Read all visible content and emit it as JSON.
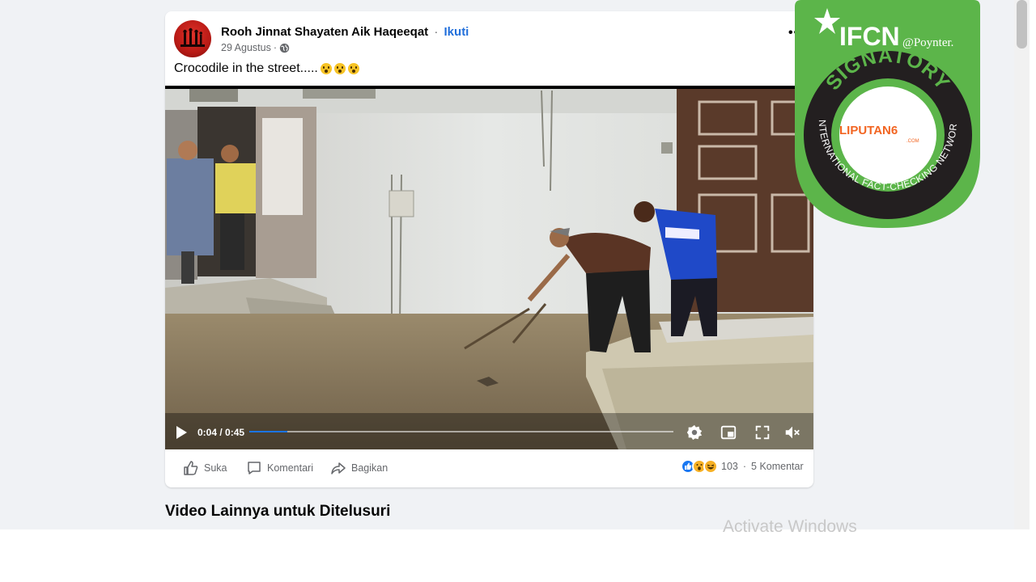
{
  "post": {
    "author": "Rooh Jinnat Shayaten Aik Haqeeqat",
    "separator": "·",
    "follow_label": "Ikuti",
    "date": "29 Agustus",
    "meta_separator": "·",
    "more_label": "•••",
    "caption": "Crocodile in the street.....",
    "caption_emoji": "hushed-face-emoji"
  },
  "video": {
    "time_current": "0:04",
    "time_separator": " / ",
    "time_total": "0:45",
    "progress": 0.09,
    "icons": [
      "play-icon",
      "settings-icon",
      "miniplayer-icon",
      "fullscreen-icon",
      "mute-icon"
    ]
  },
  "actions": {
    "like_label": "Suka",
    "comment_label": "Komentari",
    "share_label": "Bagikan"
  },
  "stats": {
    "reaction_types": [
      "like",
      "wow",
      "haha"
    ],
    "reaction_count": "103",
    "separator": "·",
    "comments": "5 Komentar"
  },
  "section_heading": "Video Lainnya untuk Ditelusuri",
  "system_watermark": "Activate Windows",
  "badge": {
    "brand": "IFCN",
    "partner": "@Poynter.",
    "status": "SIGNATORY",
    "member_logo": "LIPUTAN6",
    "member_logo_suffix": ".COM",
    "network": "INTERNATIONAL FACT-CHECKING NETWORK",
    "colors": {
      "green": "#5cb54a",
      "dark": "#231f20",
      "white": "#ffffff",
      "orange": "#f26522"
    }
  },
  "colors": {
    "link_blue": "#216fdb",
    "progress_blue": "#1b74e4",
    "page_bg": "#f0f2f5",
    "text_secondary": "#65676b"
  }
}
